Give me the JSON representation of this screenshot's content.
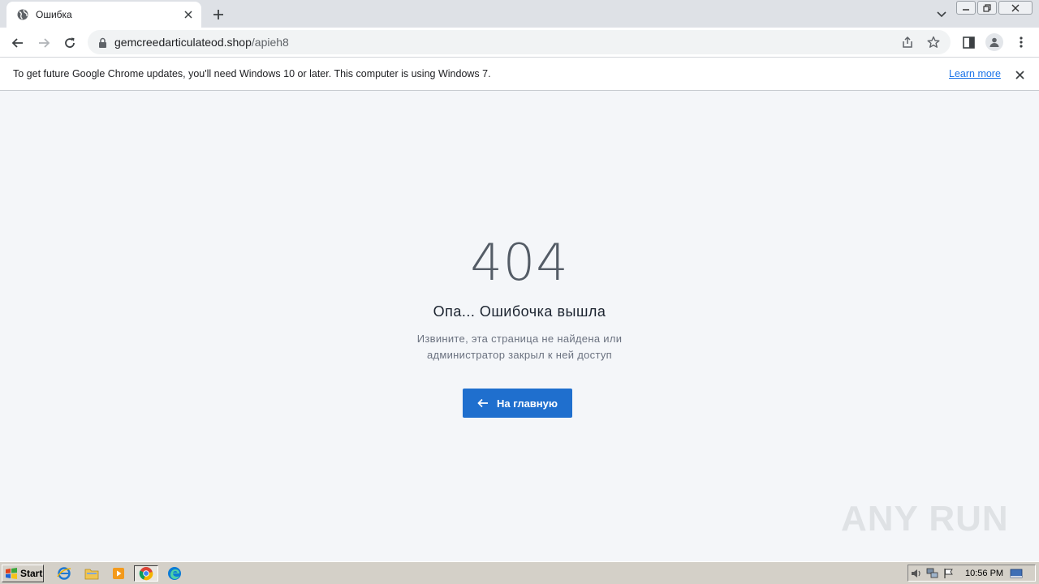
{
  "browser": {
    "tab": {
      "title": "Ошибка"
    },
    "url": {
      "host": "gemcreedarticulateod.shop",
      "path": "/apieh8"
    },
    "infobar": {
      "message": "To get future Google Chrome updates, you'll need Windows 10 or later. This computer is using Windows 7.",
      "link_label": "Learn more"
    }
  },
  "page": {
    "error_code": "404",
    "title": "Опа... Ошибочка вышла",
    "description_line1": "Извините, эта страница не найдена или",
    "description_line2": "администратор закрыл к ней доступ",
    "home_button_label": "На главную",
    "accent_color": "#1f6fce"
  },
  "watermark": {
    "text": "ANY RUN"
  },
  "taskbar": {
    "start_label": "Start",
    "clock": "10:56 PM"
  }
}
